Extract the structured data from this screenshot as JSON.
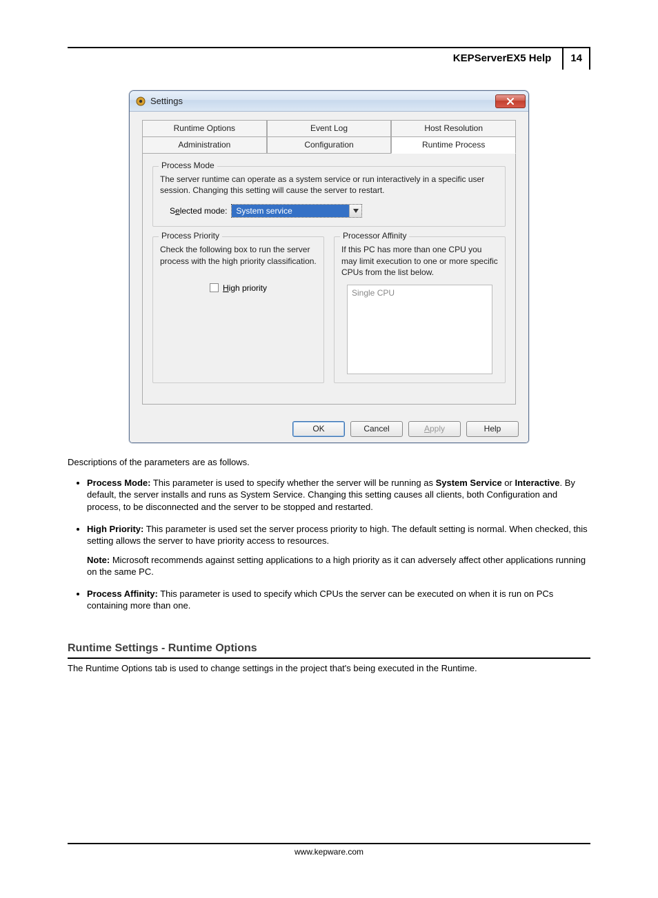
{
  "header": {
    "title": "KEPServerEX5 Help",
    "page_number": "14"
  },
  "dialog": {
    "title": "Settings",
    "tabs_row1": [
      "Runtime Options",
      "Event Log",
      "Host Resolution"
    ],
    "tabs_row2": [
      "Administration",
      "Configuration",
      "Runtime Process"
    ],
    "selected_tab": "Runtime Process",
    "process_mode": {
      "legend": "Process Mode",
      "text": "The server runtime can operate as a system service or run interactively in a specific user session.  Changing this setting will cause the server to restart.",
      "label_pre": "S",
      "label_u": "e",
      "label_post": "lected mode:",
      "selected_value": "System service"
    },
    "process_priority": {
      "legend": "Process Priority",
      "text": "Check the following box to run the server process with the high priority classification.",
      "checkbox_u": "H",
      "checkbox_post": "igh priority"
    },
    "processor_affinity": {
      "legend": "Processor Affinity",
      "text": "If this PC has more than one CPU you may limit execution to one or more specific CPUs from the list below.",
      "list_item": "Single CPU"
    },
    "buttons": {
      "ok": "OK",
      "cancel": "Cancel",
      "apply_u": "A",
      "apply_post": "pply",
      "help": "Help"
    }
  },
  "description": {
    "intro": "Descriptions of the parameters are as follows.",
    "items": [
      {
        "label": "Process Mode:",
        "pre": " This parameter is used to specify whether the server will be running as ",
        "b1": "System Service",
        "mid": " or ",
        "b2": "Interactive",
        "post": ". By default, the server installs and runs as System Service. Changing this setting causes all clients, both Configuration and process, to be disconnected and the server to be stopped and restarted."
      },
      {
        "label": "High Priority:",
        "pre": " This parameter is used set the server process priority to high. The default setting is normal. When checked, this setting allows the server to have priority access to resources.",
        "note_label": "Note:",
        "note": " Microsoft recommends against setting applications to a high priority as it can adversely affect other applications running on the same PC."
      },
      {
        "label": "Process Affinity:",
        "pre": " This parameter is used to specify which CPUs the server can be executed on when it is run on PCs containing more than one."
      }
    ]
  },
  "section": {
    "heading": "Runtime Settings - Runtime Options",
    "body": "The Runtime Options tab is used to change settings in the project that's being executed in the Runtime."
  },
  "footer": {
    "url": "www.kepware.com"
  }
}
